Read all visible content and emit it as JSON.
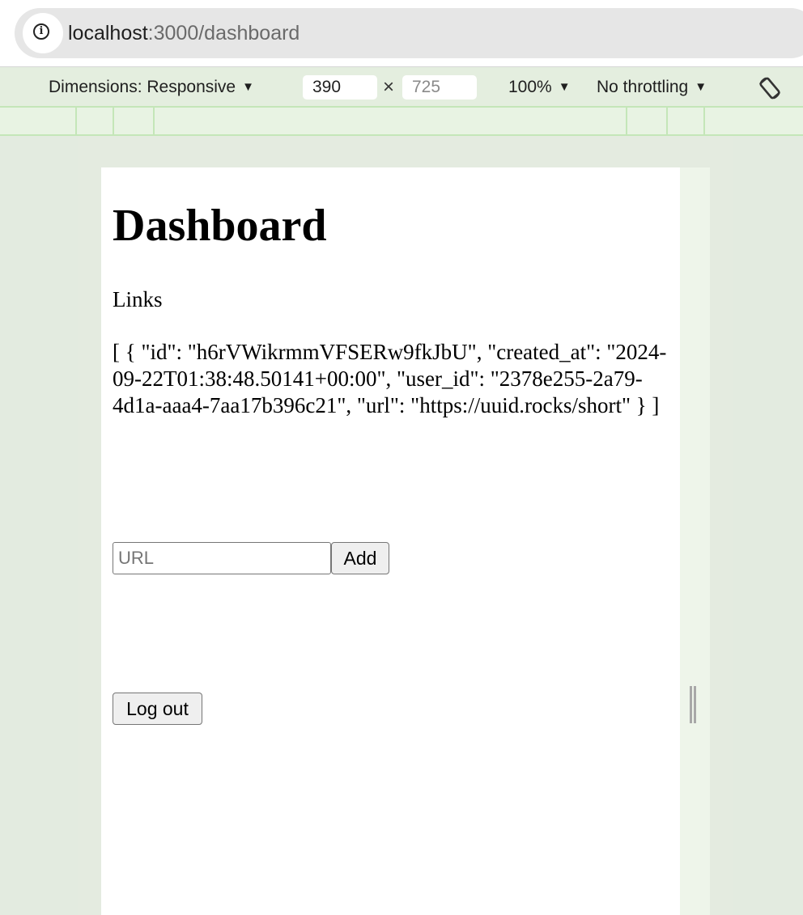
{
  "browser": {
    "url_host": "localhost",
    "url_path": ":3000/dashboard",
    "info_icon": "info-icon"
  },
  "devtools": {
    "dimensions_label": "Dimensions: Responsive",
    "width_value": "390",
    "height_placeholder": "725",
    "times_symbol": "×",
    "zoom": "100%",
    "throttling": "No throttling",
    "rotate_icon": "rotate-icon",
    "accent_color": "#c4e6b8"
  },
  "page": {
    "title": "Dashboard",
    "links_label": "Links",
    "links_json": "[ { \"id\": \"h6rVWikrmmVFSERw9fkJbU\", \"created_at\": \"2024-09-22T01:38:48.50141+00:00\", \"user_id\": \"2378e255-2a79-4d1a-aaa4-7aa17b396c21\", \"url\": \"https://uuid.rocks/short\" } ]",
    "url_input_placeholder": "URL",
    "add_label": "Add",
    "logout_label": "Log out"
  }
}
